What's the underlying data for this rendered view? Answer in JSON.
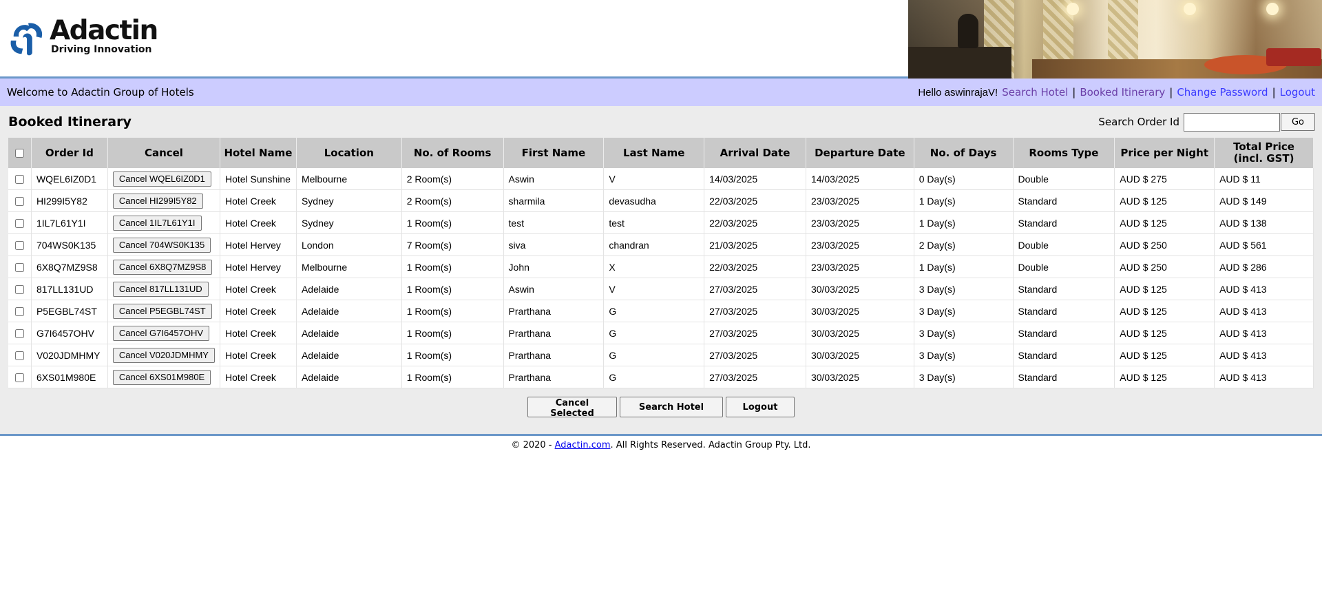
{
  "logo": {
    "name": "Adactin",
    "tagline": "Driving Innovation"
  },
  "navbar": {
    "welcome": "Welcome to Adactin Group of Hotels",
    "hello": "Hello aswinrajaV!",
    "links": [
      "Search Hotel",
      "Booked Itinerary",
      "Change Password",
      "Logout"
    ]
  },
  "page": {
    "title": "Booked Itinerary",
    "search_label": "Search Order Id",
    "search_value": "",
    "go_label": "Go"
  },
  "table": {
    "headers": [
      "Order Id",
      "Cancel",
      "Hotel Name",
      "Location",
      "No. of Rooms",
      "First Name",
      "Last Name",
      "Arrival Date",
      "Departure Date",
      "No. of Days",
      "Rooms Type",
      "Price per Night",
      "Total Price (incl. GST)"
    ],
    "rows": [
      {
        "order_id": "WQEL6IZ0D1",
        "cancel": "Cancel WQEL6IZ0D1",
        "hotel": "Hotel Sunshine",
        "location": "Melbourne",
        "rooms": "2 Room(s)",
        "first": "Aswin",
        "last": "V",
        "arrival": "14/03/2025",
        "departure": "14/03/2025",
        "days": "0 Day(s)",
        "type": "Double",
        "ppn": "AUD $ 275",
        "total": "AUD $ 11"
      },
      {
        "order_id": "HI299I5Y82",
        "cancel": "Cancel HI299I5Y82",
        "hotel": "Hotel Creek",
        "location": "Sydney",
        "rooms": "2 Room(s)",
        "first": "sharmila",
        "last": "devasudha",
        "arrival": "22/03/2025",
        "departure": "23/03/2025",
        "days": "1 Day(s)",
        "type": "Standard",
        "ppn": "AUD $ 125",
        "total": "AUD $ 149"
      },
      {
        "order_id": "1IL7L61Y1I",
        "cancel": "Cancel 1IL7L61Y1I",
        "hotel": "Hotel Creek",
        "location": "Sydney",
        "rooms": "1 Room(s)",
        "first": "test",
        "last": "test",
        "arrival": "22/03/2025",
        "departure": "23/03/2025",
        "days": "1 Day(s)",
        "type": "Standard",
        "ppn": "AUD $ 125",
        "total": "AUD $ 138"
      },
      {
        "order_id": "704WS0K135",
        "cancel": "Cancel 704WS0K135",
        "hotel": "Hotel Hervey",
        "location": "London",
        "rooms": "7 Room(s)",
        "first": "siva",
        "last": "chandran",
        "arrival": "21/03/2025",
        "departure": "23/03/2025",
        "days": "2 Day(s)",
        "type": "Double",
        "ppn": "AUD $ 250",
        "total": "AUD $ 561"
      },
      {
        "order_id": "6X8Q7MZ9S8",
        "cancel": "Cancel 6X8Q7MZ9S8",
        "hotel": "Hotel Hervey",
        "location": "Melbourne",
        "rooms": "1 Room(s)",
        "first": "John",
        "last": "X",
        "arrival": "22/03/2025",
        "departure": "23/03/2025",
        "days": "1 Day(s)",
        "type": "Double",
        "ppn": "AUD $ 250",
        "total": "AUD $ 286"
      },
      {
        "order_id": "817LL131UD",
        "cancel": "Cancel 817LL131UD",
        "hotel": "Hotel Creek",
        "location": "Adelaide",
        "rooms": "1 Room(s)",
        "first": "Aswin",
        "last": "V",
        "arrival": "27/03/2025",
        "departure": "30/03/2025",
        "days": "3 Day(s)",
        "type": "Standard",
        "ppn": "AUD $ 125",
        "total": "AUD $ 413"
      },
      {
        "order_id": "P5EGBL74ST",
        "cancel": "Cancel P5EGBL74ST",
        "hotel": "Hotel Creek",
        "location": "Adelaide",
        "rooms": "1 Room(s)",
        "first": "Prarthana",
        "last": "G",
        "arrival": "27/03/2025",
        "departure": "30/03/2025",
        "days": "3 Day(s)",
        "type": "Standard",
        "ppn": "AUD $ 125",
        "total": "AUD $ 413"
      },
      {
        "order_id": "G7I6457OHV",
        "cancel": "Cancel G7I6457OHV",
        "hotel": "Hotel Creek",
        "location": "Adelaide",
        "rooms": "1 Room(s)",
        "first": "Prarthana",
        "last": "G",
        "arrival": "27/03/2025",
        "departure": "30/03/2025",
        "days": "3 Day(s)",
        "type": "Standard",
        "ppn": "AUD $ 125",
        "total": "AUD $ 413"
      },
      {
        "order_id": "V020JDMHMY",
        "cancel": "Cancel V020JDMHMY",
        "hotel": "Hotel Creek",
        "location": "Adelaide",
        "rooms": "1 Room(s)",
        "first": "Prarthana",
        "last": "G",
        "arrival": "27/03/2025",
        "departure": "30/03/2025",
        "days": "3 Day(s)",
        "type": "Standard",
        "ppn": "AUD $ 125",
        "total": "AUD $ 413"
      },
      {
        "order_id": "6XS01M980E",
        "cancel": "Cancel 6XS01M980E",
        "hotel": "Hotel Creek",
        "location": "Adelaide",
        "rooms": "1 Room(s)",
        "first": "Prarthana",
        "last": "G",
        "arrival": "27/03/2025",
        "departure": "30/03/2025",
        "days": "3 Day(s)",
        "type": "Standard",
        "ppn": "AUD $ 125",
        "total": "AUD $ 413"
      }
    ]
  },
  "actions": {
    "cancel_selected": "Cancel Selected",
    "search_hotel": "Search Hotel",
    "logout": "Logout"
  },
  "footer": {
    "prefix": "© 2020 - ",
    "link": "Adactin.com",
    "suffix": ". All Rights Reserved. Adactin Group Pty. Ltd."
  },
  "colors": {
    "navbar_bg": "#ccccff",
    "header_rule": "#6b97c9",
    "link": "#3b3bff",
    "visited_link": "#6b3fa8",
    "table_header": "#c9c9c9",
    "logo_blue": "#1a5ea8"
  }
}
